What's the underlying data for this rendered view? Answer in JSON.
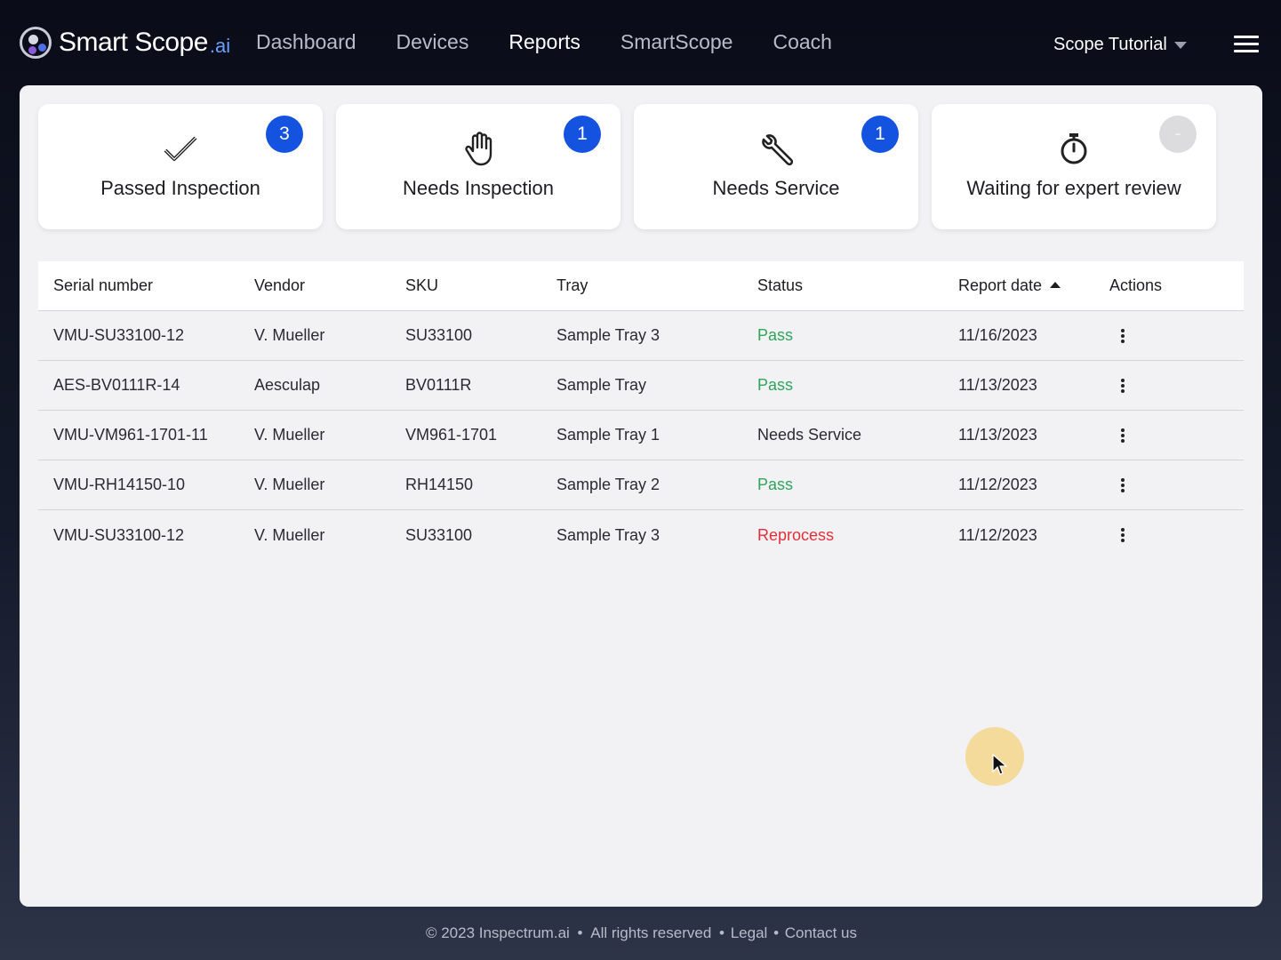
{
  "brand": {
    "name": "Smart Scope",
    "suffix": ".ai"
  },
  "nav": {
    "items": [
      {
        "label": "Dashboard",
        "active": false
      },
      {
        "label": "Devices",
        "active": false
      },
      {
        "label": "Reports",
        "active": true
      },
      {
        "label": "SmartScope",
        "active": false
      },
      {
        "label": "Coach",
        "active": false
      }
    ],
    "account_label": "Scope Tutorial"
  },
  "summary_cards": [
    {
      "label": "Passed Inspection",
      "count": "3",
      "icon": "checkmark-icon"
    },
    {
      "label": "Needs Inspection",
      "count": "1",
      "icon": "hand-icon"
    },
    {
      "label": "Needs Service",
      "count": "1",
      "icon": "wrench-icon"
    },
    {
      "label": "Waiting for expert review",
      "count": "-",
      "icon": "stopwatch-icon"
    }
  ],
  "table": {
    "columns": [
      "Serial number",
      "Vendor",
      "SKU",
      "Tray",
      "Status",
      "Report date",
      "Actions"
    ],
    "sorted_column": "Report date",
    "sort_direction": "ascending",
    "rows": [
      {
        "serial": "VMU-SU33100-12",
        "vendor": "V. Mueller",
        "sku": "SU33100",
        "tray": "Sample Tray 3",
        "status": "Pass",
        "date": "11/16/2023"
      },
      {
        "serial": "AES-BV0111R-14",
        "vendor": "Aesculap",
        "sku": "BV0111R",
        "tray": "Sample Tray",
        "status": "Pass",
        "date": "11/13/2023"
      },
      {
        "serial": "VMU-VM961-1701-11",
        "vendor": "V. Mueller",
        "sku": "VM961-1701",
        "tray": "Sample Tray 1",
        "status": "Needs Service",
        "date": "11/13/2023"
      },
      {
        "serial": "VMU-RH14150-10",
        "vendor": "V. Mueller",
        "sku": "RH14150",
        "tray": "Sample Tray 2",
        "status": "Pass",
        "date": "11/12/2023"
      },
      {
        "serial": "VMU-SU33100-12",
        "vendor": "V. Mueller",
        "sku": "SU33100",
        "tray": "Sample Tray 3",
        "status": "Reprocess",
        "date": "11/12/2023"
      }
    ]
  },
  "colors": {
    "badge": "#1452e0",
    "pass": "#2ea55a",
    "reprocess": "#e0303a",
    "accent": "#6aa0ff"
  },
  "footer": {
    "copyright": "© 2023 Inspectrum.ai",
    "rights": "All rights reserved",
    "legal": "Legal",
    "contact": "Contact us"
  }
}
